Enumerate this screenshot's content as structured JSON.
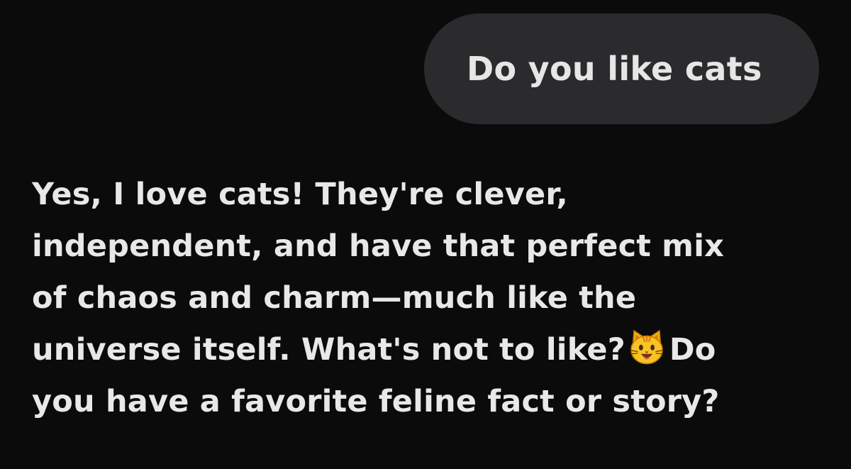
{
  "user_message": {
    "text": "Do you like cats"
  },
  "assistant_message": {
    "lines": [
      "Yes, I love cats! They're clever,",
      "independent, and have that perfect mix",
      "of chaos and charm—much like the",
      "universe itself. What's not to like?",
      "you have a favorite feline fact or story?"
    ],
    "line4_after_emoji": "Do",
    "emoji": "smiling-cat-face-icon"
  },
  "colors": {
    "background": "#0b0b0c",
    "bubble": "#2b2b2d",
    "text": "#e8e8e8"
  }
}
